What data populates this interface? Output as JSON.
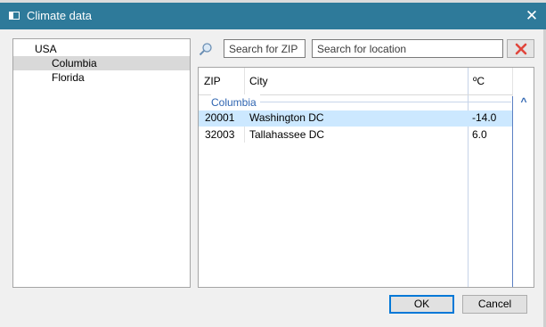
{
  "window": {
    "title": "Climate data",
    "close_glyph": "✕",
    "accent_color": "#2e7a9a"
  },
  "tree": {
    "root": "USA",
    "children": [
      "Columbia",
      "Florida"
    ],
    "selected": "Columbia"
  },
  "search": {
    "zip_placeholder": "Search for ZIP",
    "location_placeholder": "Search for location",
    "search_icon": "magnifier-icon",
    "clear_icon": "red-x-icon"
  },
  "grid": {
    "columns": [
      "ZIP",
      "City",
      "ºC"
    ],
    "group": {
      "label": "Columbia",
      "collapse_glyph": "^"
    },
    "rows": [
      {
        "zip": "20001",
        "city": "Washington DC",
        "temp": "-14.0",
        "selected": true
      },
      {
        "zip": "32003",
        "city": "Tallahassee DC",
        "temp": "6.0",
        "selected": false
      }
    ]
  },
  "buttons": {
    "ok": "OK",
    "cancel": "Cancel"
  }
}
